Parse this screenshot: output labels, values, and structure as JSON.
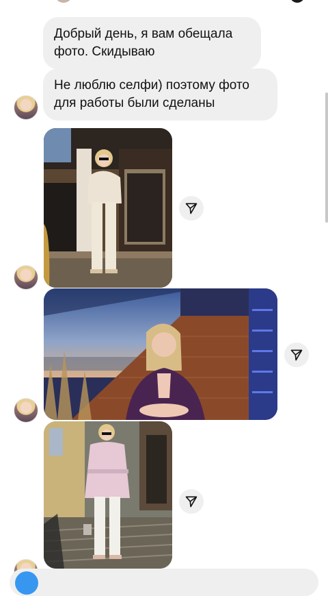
{
  "messages": [
    {
      "text": "Добрый день,  я вам обещала\nфото.  Скидываю"
    },
    {
      "text": "Не люблю селфи) поэтому фото\nдля работы были сделаны"
    }
  ],
  "attachments": [
    {
      "type": "photo",
      "description": "woman in cream outfit near revolving door",
      "action": "share"
    },
    {
      "type": "photo",
      "description": "woman in purple blazer at terrace with sunset",
      "action": "share"
    },
    {
      "type": "photo",
      "description": "woman in pink belted jacket on stairs",
      "action": "share"
    }
  ],
  "colors": {
    "bubble": "#efefef",
    "accent": "#3797f0",
    "background": "#ffffff"
  },
  "icons": {
    "share": "paper-plane-icon",
    "camera": "camera-icon"
  }
}
